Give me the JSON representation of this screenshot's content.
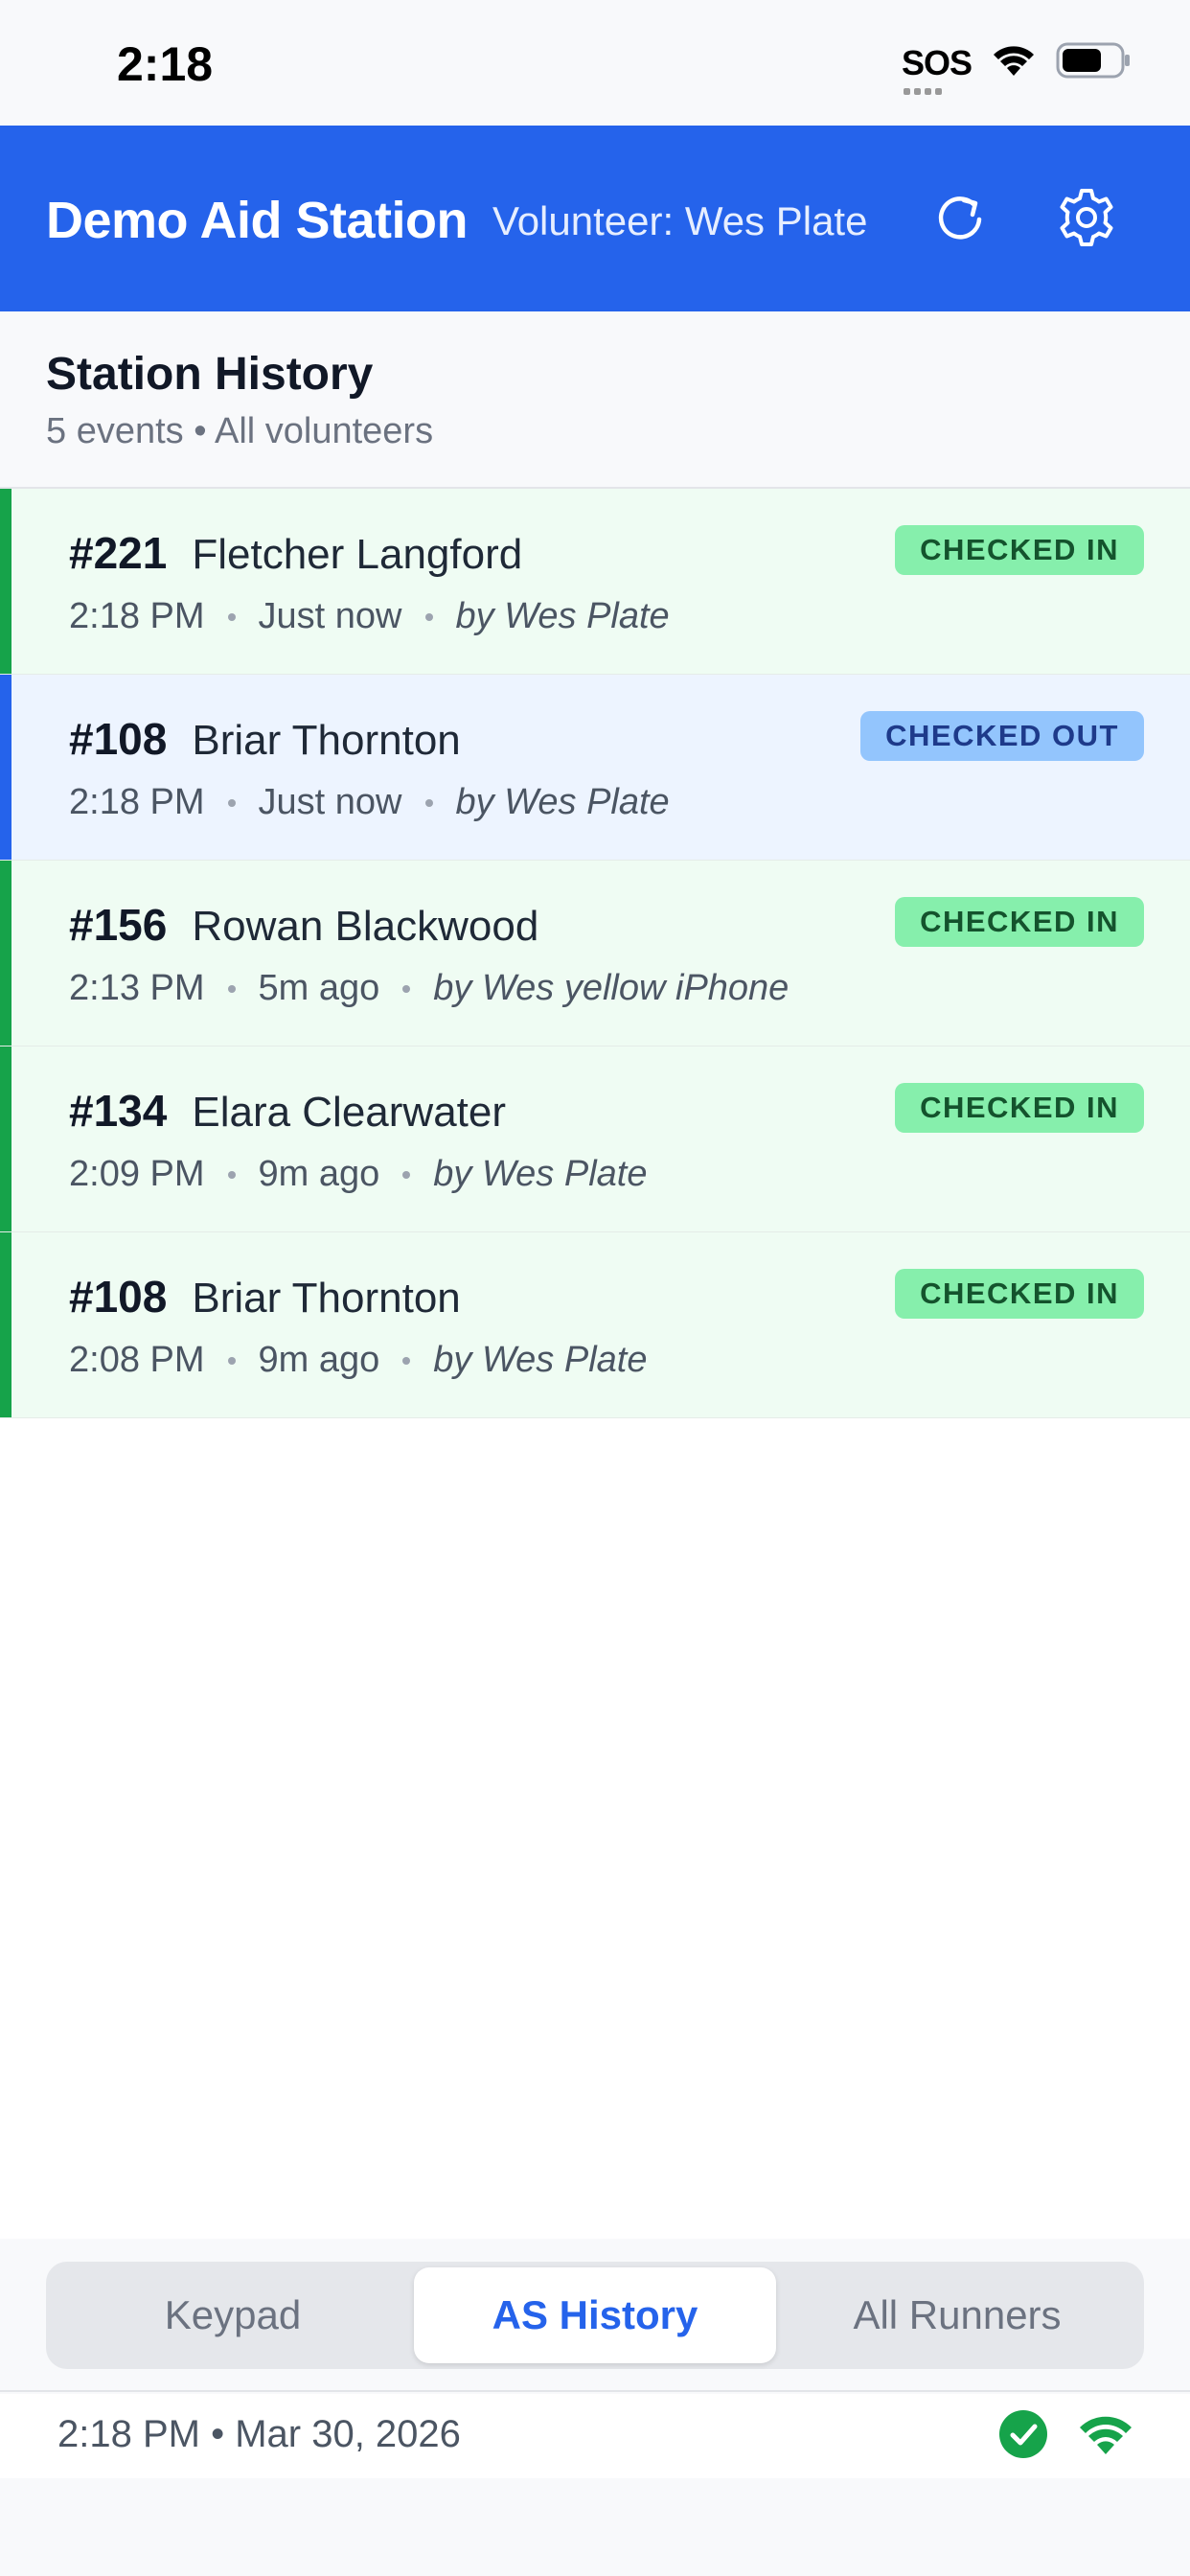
{
  "status_bar": {
    "time": "2:18",
    "sos_label": "SOS",
    "icons": [
      "sos-indicator",
      "wifi-icon",
      "battery-icon"
    ]
  },
  "header": {
    "title": "Demo Aid Station",
    "volunteer": "Volunteer: Wes Plate",
    "background_color": "#2563eb",
    "icons": [
      "refresh-icon",
      "gear-icon"
    ]
  },
  "section": {
    "title": "Station History",
    "subtitle": "5 events • All volunteers"
  },
  "events": [
    {
      "bib": "#221",
      "name": "Fletcher Langford",
      "time": "2:18 PM",
      "ago": "Just now",
      "by": "by Wes Plate",
      "status": "CHECKED IN"
    },
    {
      "bib": "#108",
      "name": "Briar Thornton",
      "time": "2:18 PM",
      "ago": "Just now",
      "by": "by Wes Plate",
      "status": "CHECKED OUT"
    },
    {
      "bib": "#156",
      "name": "Rowan Blackwood",
      "time": "2:13 PM",
      "ago": "5m ago",
      "by": "by Wes yellow iPhone",
      "status": "CHECKED IN"
    },
    {
      "bib": "#134",
      "name": "Elara Clearwater",
      "time": "2:09 PM",
      "ago": "9m ago",
      "by": "by Wes Plate",
      "status": "CHECKED IN"
    },
    {
      "bib": "#108",
      "name": "Briar Thornton",
      "time": "2:08 PM",
      "ago": "9m ago",
      "by": "by Wes Plate",
      "status": "CHECKED IN"
    }
  ],
  "status_colors": {
    "checked_in_badge": "#86efac",
    "checked_in_row": "#effcf3",
    "checked_in_accent": "#16a34a",
    "checked_out_badge": "#93c5fd",
    "checked_out_row": "#edf4ff",
    "checked_out_accent": "#2563eb"
  },
  "tabs": [
    {
      "label": "Keypad",
      "active": false
    },
    {
      "label": "AS History",
      "active": true
    },
    {
      "label": "All Runners",
      "active": false
    }
  ],
  "footer": {
    "datetime": "2:18 PM • Mar 30, 2026",
    "icons": [
      "sync-ok-check-icon",
      "wifi-connected-icon"
    ],
    "ok_color": "#16a34a"
  }
}
